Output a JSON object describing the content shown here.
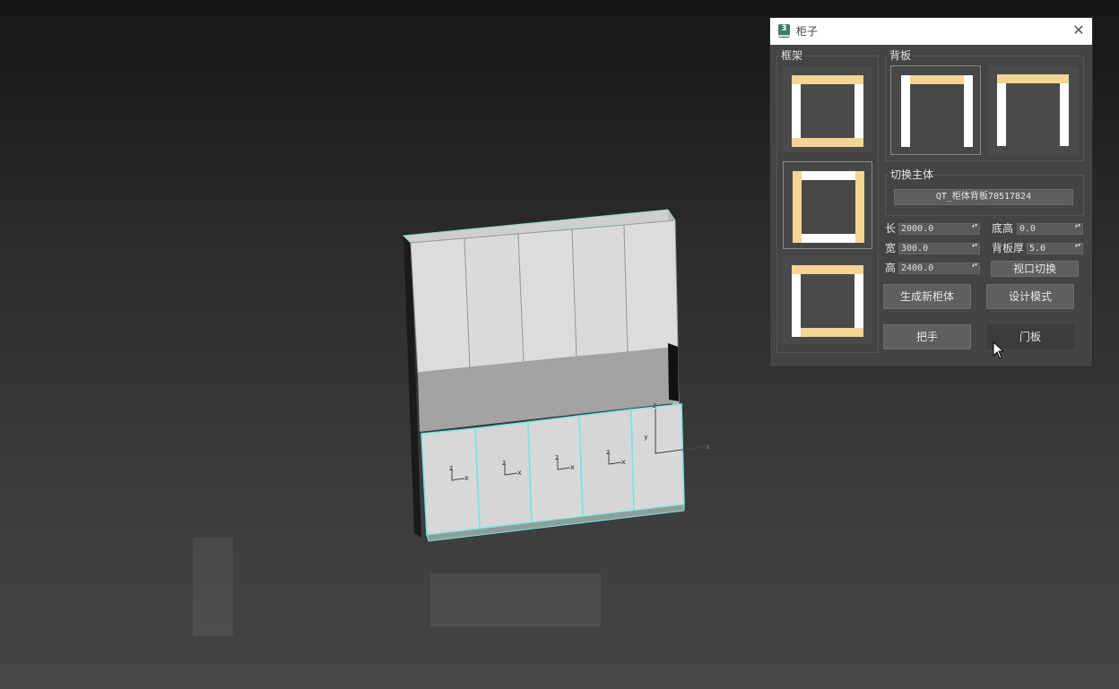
{
  "dialog": {
    "title": "柜子",
    "app_icon_text": "3",
    "close_glyph": "✕",
    "frame_group_label": "框架",
    "back_group_label": "背板",
    "switch_group_label": "切换主体",
    "switch_value": "QT_柜体背板70517824",
    "fields": {
      "length_label": "长",
      "length_value": "2000.0",
      "width_label": "宽",
      "width_value": "300.0",
      "height_label": "高",
      "height_value": "2400.0",
      "base_height_label": "底高",
      "base_height_value": "0.0",
      "back_thickness_label": "背板厚",
      "back_thickness_value": "5.0"
    },
    "buttons": {
      "view_switch": "视口切换",
      "generate": "生成新柜体",
      "design_mode": "设计模式",
      "handle": "把手",
      "door": "门板"
    },
    "spin_arrow_glyph": "▲▼"
  },
  "viewport": {
    "gizmo_labels": [
      "z",
      "x",
      "z",
      "x",
      "z",
      "x",
      "z",
      "x",
      "y",
      "z",
      "x"
    ]
  },
  "colors": {
    "accent_panel": "#f5d594",
    "panel_white": "#ffffff",
    "selection": "#6fe8e0"
  }
}
